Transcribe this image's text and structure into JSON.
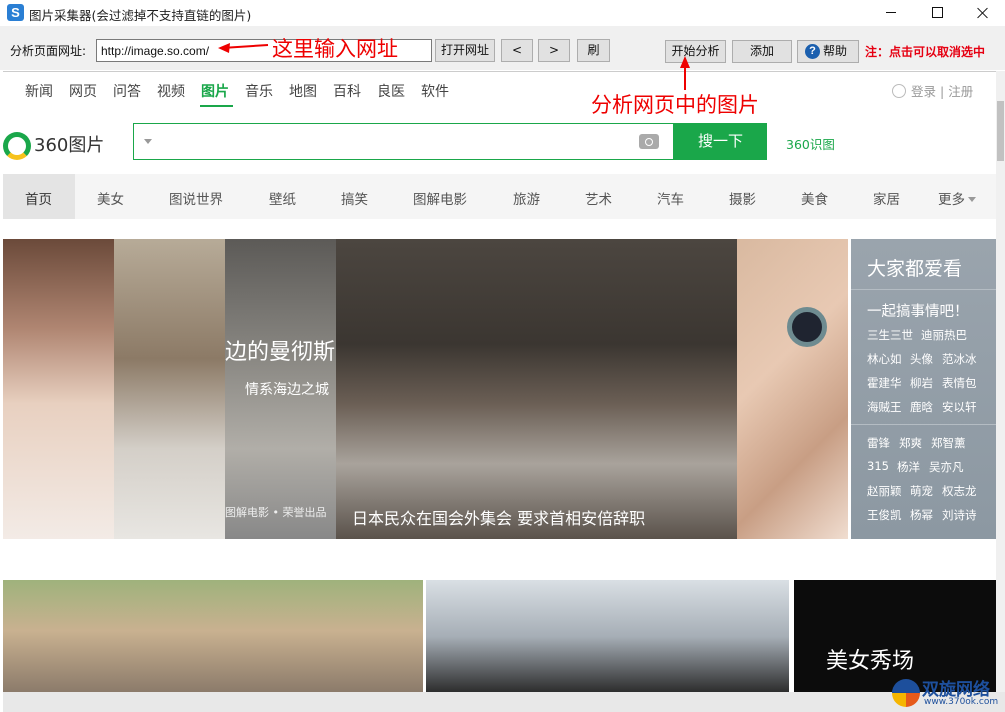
{
  "window": {
    "title": "图片采集器(会过滤掉不支持直链的图片)",
    "app_icon_letter": "S"
  },
  "toolbar": {
    "url_label": "分析页面网址:",
    "url_value": "http://image.so.com/",
    "open_label": "打开网址",
    "back_label": "<",
    "forward_label": ">",
    "refresh_label": "刷",
    "analyze_label": "开始分析",
    "add_label": "添加",
    "help_label": "帮助",
    "note": "注：点击可以取消选中"
  },
  "annotations": {
    "url_hint": "这里输入网址",
    "analyze_hint": "分析网页中的图片",
    "color": "#e00000"
  },
  "site": {
    "top_nav": [
      "新闻",
      "网页",
      "问答",
      "视频",
      "图片",
      "音乐",
      "地图",
      "百科",
      "良医",
      "软件"
    ],
    "active_nav": "图片",
    "login": "登录",
    "register": "注册",
    "login_sep": "|",
    "logo_text": "360图片",
    "search_placeholder": "",
    "search_button": "搜一下",
    "shitu_link": "360识图",
    "categories": [
      "首页",
      "美女",
      "图说世界",
      "壁纸",
      "搞笑",
      "图解电影",
      "旅游",
      "艺术",
      "汽车",
      "摄影",
      "美食",
      "家居",
      "更多"
    ],
    "accent": "#1aa74a"
  },
  "gallery": {
    "movie_caption_big": "边的曼彻斯",
    "movie_caption_small": "情系海边之城",
    "movie_credit": "图解电影 • 荣誉出品",
    "protest_caption": "日本民众在国会外集会 要求首相安倍辞职",
    "side_title": "大家都爱看",
    "side_subtitle": "一起搞事情吧！",
    "side_names_a": [
      "三生三世",
      "迪丽热巴",
      "林心如",
      "头像",
      "范冰冰",
      "霍建华",
      "柳岩",
      "表情包",
      "海贼王",
      "鹿晗",
      "安以轩"
    ],
    "side_names_b": [
      "雷锋",
      "郑爽",
      "郑智薰",
      "315",
      "杨洋",
      "吴亦凡",
      "赵丽颖",
      "萌宠",
      "权志龙",
      "王俊凯",
      "杨幂",
      "刘诗诗"
    ],
    "beauty_title": "美女秀场"
  },
  "watermark": {
    "text": "双旋网络",
    "url": "www.370ok.com"
  }
}
